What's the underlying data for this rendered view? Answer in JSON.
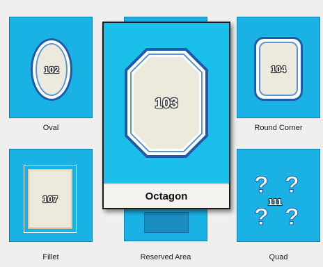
{
  "tiles": {
    "oval": {
      "label": "Oval",
      "number": "102"
    },
    "round_corner": {
      "label": "Round Corner",
      "number": "104"
    },
    "fillet": {
      "label": "Fillet",
      "number": "107"
    },
    "reserved_area": {
      "label": "Reserved Area"
    },
    "quad": {
      "label": "Quad",
      "number": "111",
      "glyph": "?"
    }
  },
  "popup": {
    "label": "Octagon",
    "number": "103"
  },
  "colors": {
    "tile_bg": "#1ab2e5",
    "popup_bg": "#1bc0ea",
    "frame_border": "#1f5aa8",
    "page_bg": "#f0efed"
  }
}
